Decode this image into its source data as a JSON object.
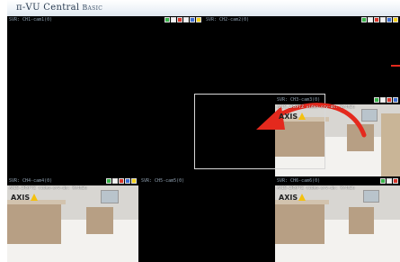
{
  "window": {
    "title": "π-VU Central",
    "subtitle": "Basic"
  },
  "cameras": [
    {
      "id": "cam1",
      "label": "SVR: CH1-cam1(0)",
      "has_feed": false
    },
    {
      "id": "cam2",
      "label": "SVR: CH2-cam2(0)",
      "has_feed": false
    },
    {
      "id": "cam3",
      "label": "SVR: CH3-cam3(0)",
      "has_feed": true,
      "caption": "AXIS-2RxPTZ video-srv-ds: 9x4m2u"
    },
    {
      "id": "cam4",
      "label": "SVR: CH4-cam4(0)",
      "has_feed": true,
      "caption": "AXIS-2RxPTZ video-srv-ds: 9x4m2u"
    },
    {
      "id": "cam5",
      "label": "SVR: CH5-cam5(0)",
      "has_feed": false
    },
    {
      "id": "cam6",
      "label": "SVR: CH6-cam6(0)",
      "has_feed": true,
      "caption": "AXIS-2RxPTZ video-srv-ds: 9x4m2u"
    }
  ],
  "logo_text": "AXIS",
  "colors": {
    "arrow": "#e4291d",
    "tool_green": "#39b54a",
    "tool_red": "#d9362b",
    "tool_yellow": "#f4d21c",
    "tool_blue": "#3d6fd4"
  },
  "icons": [
    "green-tool-icon",
    "white-tool-icon",
    "red-tool-icon",
    "yellow-tool-icon",
    "blue-tool-icon",
    "drag-arrow-icon"
  ]
}
